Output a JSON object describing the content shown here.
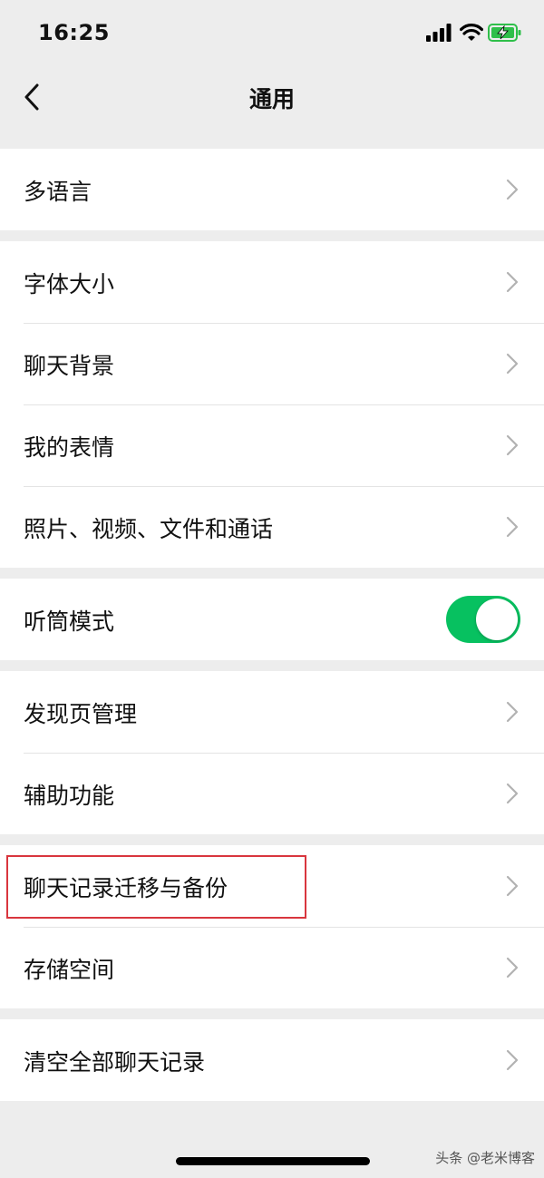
{
  "status_bar": {
    "time": "16:25",
    "icons": [
      "signal-icon",
      "wifi-icon",
      "battery-charging-icon"
    ],
    "battery_color": "#2fbf4a"
  },
  "nav": {
    "title": "通用",
    "back_icon": "chevron-left-icon"
  },
  "groups": [
    {
      "items": [
        {
          "label": "多语言"
        }
      ]
    },
    {
      "items": [
        {
          "label": "字体大小"
        },
        {
          "label": "聊天背景"
        },
        {
          "label": "我的表情"
        },
        {
          "label": "照片、视频、文件和通话"
        }
      ]
    },
    {
      "items": [
        {
          "label": "听筒模式",
          "toggle": true,
          "on": true
        }
      ]
    },
    {
      "items": [
        {
          "label": "发现页管理"
        },
        {
          "label": "辅助功能"
        }
      ]
    },
    {
      "items": [
        {
          "label": "聊天记录迁移与备份",
          "highlighted": true
        },
        {
          "label": "存储空间"
        }
      ]
    },
    {
      "items": [
        {
          "label": "清空全部聊天记录"
        }
      ]
    }
  ],
  "colors": {
    "background": "#ededed",
    "toggle_on": "#07c160",
    "highlight": "#d9363e"
  },
  "watermark": "头条 @老米博客"
}
